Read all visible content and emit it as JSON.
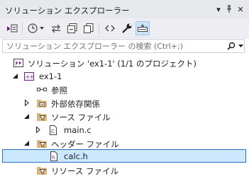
{
  "window": {
    "title": "ソリューション エクスプローラー",
    "controls": {
      "menu_glyph": "▾",
      "pin_glyph": "ᵖ",
      "close_glyph": "✕"
    }
  },
  "toolbar": {
    "buttons": [
      {
        "name": "switch-views-icon"
      },
      {
        "name": "home-icon"
      },
      {
        "name": "history-icon"
      },
      {
        "name": "sync-icon"
      },
      {
        "name": "collapse-all-icon"
      },
      {
        "name": "show-all-files-icon"
      },
      {
        "name": "code-view-icon"
      },
      {
        "name": "properties-wrench-icon"
      },
      {
        "name": "preview-selected-icon",
        "pressed": true
      }
    ]
  },
  "search": {
    "placeholder": "ソリューション エクスプローラー の検索 (Ctrl+;)"
  },
  "tree": [
    {
      "label": "ソリューション 'ex1-1' (1/1 のプロジェクト)",
      "icon": "solution-icon",
      "depth": 0,
      "expanded": null
    },
    {
      "label": "ex1-1",
      "icon": "cpp-project-icon",
      "depth": 1,
      "expanded": true
    },
    {
      "label": "参照",
      "icon": "references-icon",
      "depth": 2,
      "expanded": null
    },
    {
      "label": "外部依存関係",
      "icon": "external-deps-icon",
      "depth": 2,
      "expanded": false
    },
    {
      "label": "ソース ファイル",
      "icon": "filter-folder-icon",
      "depth": 2,
      "expanded": true
    },
    {
      "label": "main.c",
      "icon": "c-file-icon",
      "depth": 3,
      "expanded": false
    },
    {
      "label": "ヘッダー ファイル",
      "icon": "filter-folder-icon",
      "depth": 2,
      "expanded": true
    },
    {
      "label": "calc.h",
      "icon": "h-file-icon",
      "depth": 3,
      "expanded": null,
      "selected": true
    },
    {
      "label": "リソース ファイル",
      "icon": "filter-folder-icon",
      "depth": 2,
      "expanded": null
    }
  ],
  "colors": {
    "title_bg": "#e7e8ec",
    "toolbar_bg": "#eeeef2",
    "selection_bg": "#cce8ff",
    "selection_border": "#2b6cc4",
    "vs_purple": "#68217a",
    "folder_yellow": "#dcb67a"
  }
}
